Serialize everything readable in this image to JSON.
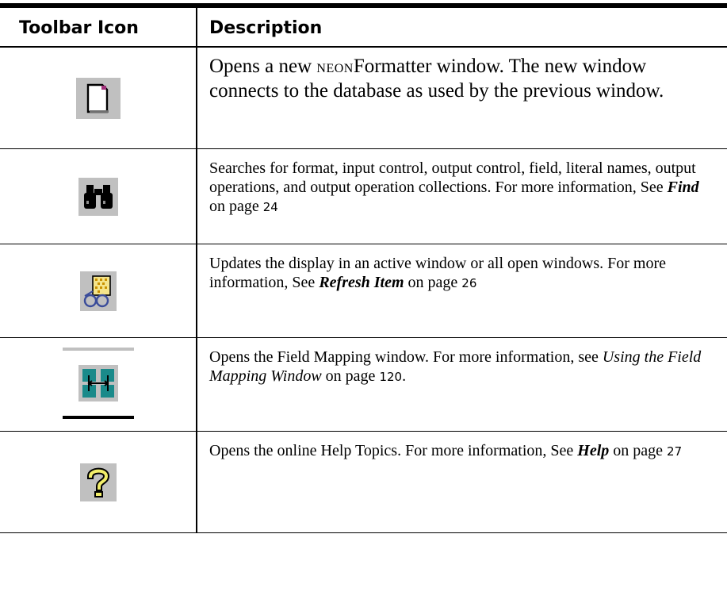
{
  "table": {
    "headers": {
      "icon": "Toolbar Icon",
      "description": "Description"
    },
    "rows": [
      {
        "icon": "new-document-icon",
        "description": {
          "pre": "Opens a new ",
          "smallcaps": "NEON",
          "post": "Formatter window. The new window connects to the database as used by the previous window."
        }
      },
      {
        "icon": "binoculars-icon",
        "description": {
          "text": "Searches for format, input control, output control, field, literal names, output operations, and output operation collections. For more information, See ",
          "link": "Find",
          "on": " on page ",
          "page": "24"
        }
      },
      {
        "icon": "refresh-item-icon",
        "description": {
          "text": "Updates the display in an active window or all open windows. For more information, See ",
          "link": "Refresh Item",
          "on": " on page ",
          "page": "26"
        }
      },
      {
        "icon": "field-mapping-icon",
        "description": {
          "text": "Opens the Field Mapping window. For more information, see ",
          "link": "Using the Field Mapping Window",
          "on": " on page ",
          "page": "120",
          "tail": "."
        }
      },
      {
        "icon": "help-question-icon",
        "description": {
          "text": "Opens the online Help Topics. For more information, See ",
          "link": "Help",
          "on": " on page ",
          "page": "27"
        }
      }
    ]
  }
}
